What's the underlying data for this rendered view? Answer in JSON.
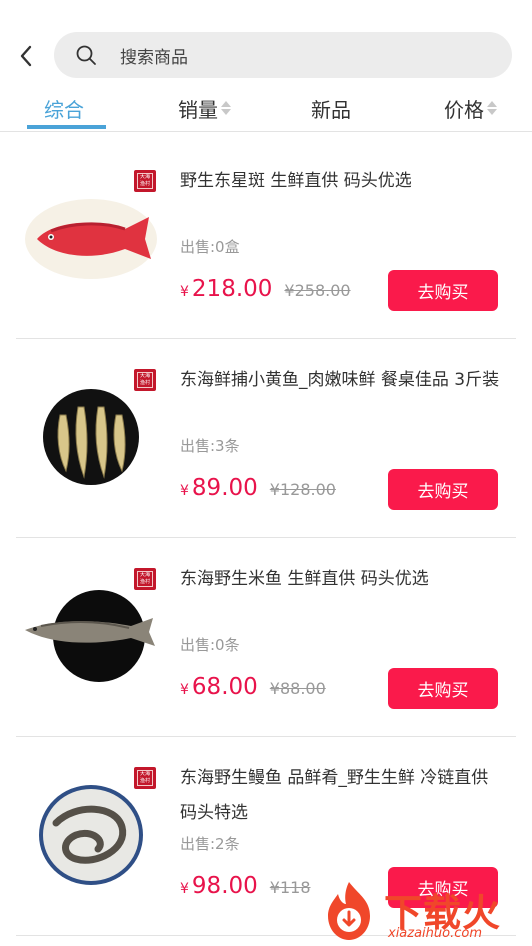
{
  "search": {
    "placeholder": "搜索商品"
  },
  "tabs": [
    {
      "label": "综合"
    },
    {
      "label": "销量"
    },
    {
      "label": "新品"
    },
    {
      "label": "价格"
    }
  ],
  "accent_color": "#4aa3d8",
  "price_color": "#e8134b",
  "products": [
    {
      "title": "野生东星斑 生鲜直供 码头优选",
      "sold": "出售:0盒",
      "currency": "¥",
      "price": "218.00",
      "original_price": "¥258.00",
      "buy_label": "去购买",
      "badge": "大海渔村"
    },
    {
      "title": "东海鲜捕小黄鱼_肉嫩味鲜 餐桌佳品 3斤装",
      "sold": "出售:3条",
      "currency": "¥",
      "price": "89.00",
      "original_price": "¥128.00",
      "buy_label": "去购买",
      "badge": "大海渔村"
    },
    {
      "title": "东海野生米鱼 生鲜直供 码头优选",
      "sold": "出售:0条",
      "currency": "¥",
      "price": "68.00",
      "original_price": "¥88.00",
      "buy_label": "去购买",
      "badge": "大海渔村"
    },
    {
      "title": "东海野生鳗鱼 品鲜肴_野生生鲜 冷链直供 码头特选",
      "sold": "出售:2条",
      "currency": "¥",
      "price": "98.00",
      "original_price": "¥118",
      "buy_label": "去购买",
      "badge": "大海渔村"
    }
  ],
  "watermark": {
    "text": "下载火",
    "url": "xiazaihuo.com"
  }
}
